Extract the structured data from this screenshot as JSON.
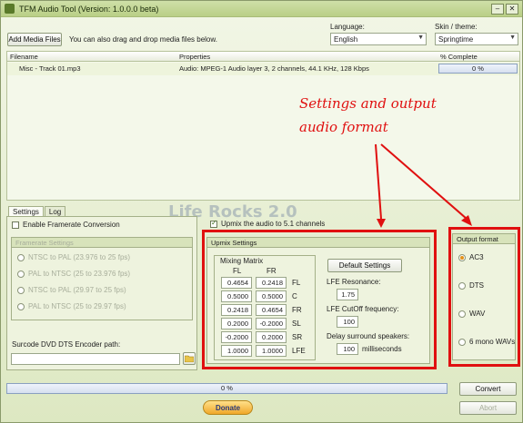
{
  "window": {
    "title": "TFM Audio Tool   (Version: 1.0.0.0 beta)"
  },
  "toolbar": {
    "add_media_label": "Add Media Files",
    "drag_hint": "You can also drag and drop media files below.",
    "language_label": "Language:",
    "language_value": "English",
    "skin_label": "Skin / theme:",
    "skin_value": "Springtime"
  },
  "filelist": {
    "columns": [
      "Filename",
      "Properties",
      "% Complete"
    ],
    "rows": [
      {
        "filename": "Misc - Track 01.mp3",
        "properties": "Audio: MPEG-1 Audio layer 3, 2 channels, 44.1 KHz, 128 Kbps",
        "complete": "0 %",
        "complete_value": 0
      }
    ]
  },
  "annotation": {
    "line1": "Settings and output",
    "line2": "audio format",
    "color": "#e01010"
  },
  "tabs": [
    "Settings",
    "Log"
  ],
  "settings": {
    "framerate_checkbox": "Enable Framerate Conversion",
    "framerate_group": "Framerate Settings",
    "framerate_options": [
      "NTSC to PAL (23.976 to 25 fps)",
      "PAL to NTSC (25 to 23.976 fps)",
      "NTSC to PAL (29.97 to 25 fps)",
      "PAL to NTSC (25 to 29.97 fps)"
    ],
    "surcode_label": "Surcode DVD DTS Encoder path:",
    "surcode_value": ""
  },
  "upmix": {
    "checkbox_label": "Upmix the audio to 5.1 channels",
    "group_title": "Upmix Settings",
    "matrix_title": "Mixing Matrix",
    "col_fl": "FL",
    "col_fr": "FR",
    "rows": [
      {
        "fl": "0.4654",
        "fr": "0.2418",
        "ch": "FL"
      },
      {
        "fl": "0.5000",
        "fr": "0.5000",
        "ch": "C"
      },
      {
        "fl": "0.2418",
        "fr": "0.4654",
        "ch": "FR"
      },
      {
        "fl": "0.2000",
        "fr": "-0.2000",
        "ch": "SL"
      },
      {
        "fl": "-0.2000",
        "fr": "0.2000",
        "ch": "SR"
      },
      {
        "fl": "1.0000",
        "fr": "1.0000",
        "ch": "LFE"
      }
    ],
    "default_button": "Default Settings",
    "lfe_resonance_label": "LFE Resonance:",
    "lfe_resonance_value": "1.75",
    "lfe_cutoff_label": "LFE CutOff frequency:",
    "lfe_cutoff_value": "100",
    "delay_label": "Delay surround speakers:",
    "delay_value": "100",
    "delay_unit": "milliseconds"
  },
  "output": {
    "group_title": "Output format",
    "options": [
      "AC3",
      "DTS",
      "WAV",
      "6 mono WAVs"
    ],
    "selected": "AC3"
  },
  "footer": {
    "progress_text": "0 %",
    "progress_value": 0,
    "convert_label": "Convert",
    "abort_label": "Abort",
    "donate_label": "Donate"
  },
  "watermark": "Life Rocks 2.0"
}
